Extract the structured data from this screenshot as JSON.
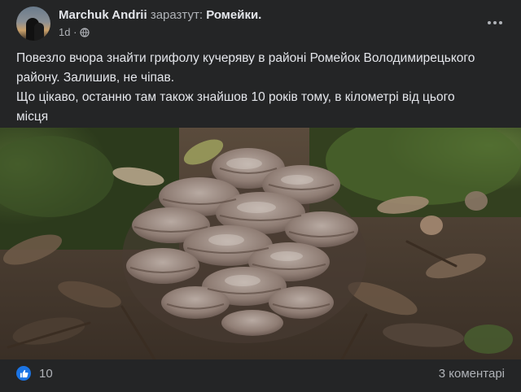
{
  "post": {
    "author": {
      "name": "Marchuk Andrii",
      "status": "заразтут:",
      "place": "Ромейки.",
      "time": "1d ·",
      "privacy_icon": "globe-icon",
      "avatar_icon": "avatar"
    },
    "menu_icon": "more-options-icon",
    "text_lines": [
      "Повезло вчора знайти грифолу кучеряву в районі Ромейок Володимирецького",
      "району. Залишив, не чіпав.",
      "Що цікаво, останню там також знайшов 10 років тому, в кілометрі від цього",
      "місця"
    ],
    "photo": {
      "subject": "grifola-frondosa-mushroom",
      "colors": {
        "moss": "#3f5a2a",
        "leaves": "#5a4a3a",
        "mushroom": "#9a8a80"
      }
    },
    "reactions": {
      "icon": "like-icon",
      "count": "10"
    },
    "comments_label": "3 коментарі"
  },
  "theme": {
    "background": "#242526",
    "text": "#e4e6eb",
    "muted": "#b0b3b8",
    "accent": "#1b74e4"
  }
}
